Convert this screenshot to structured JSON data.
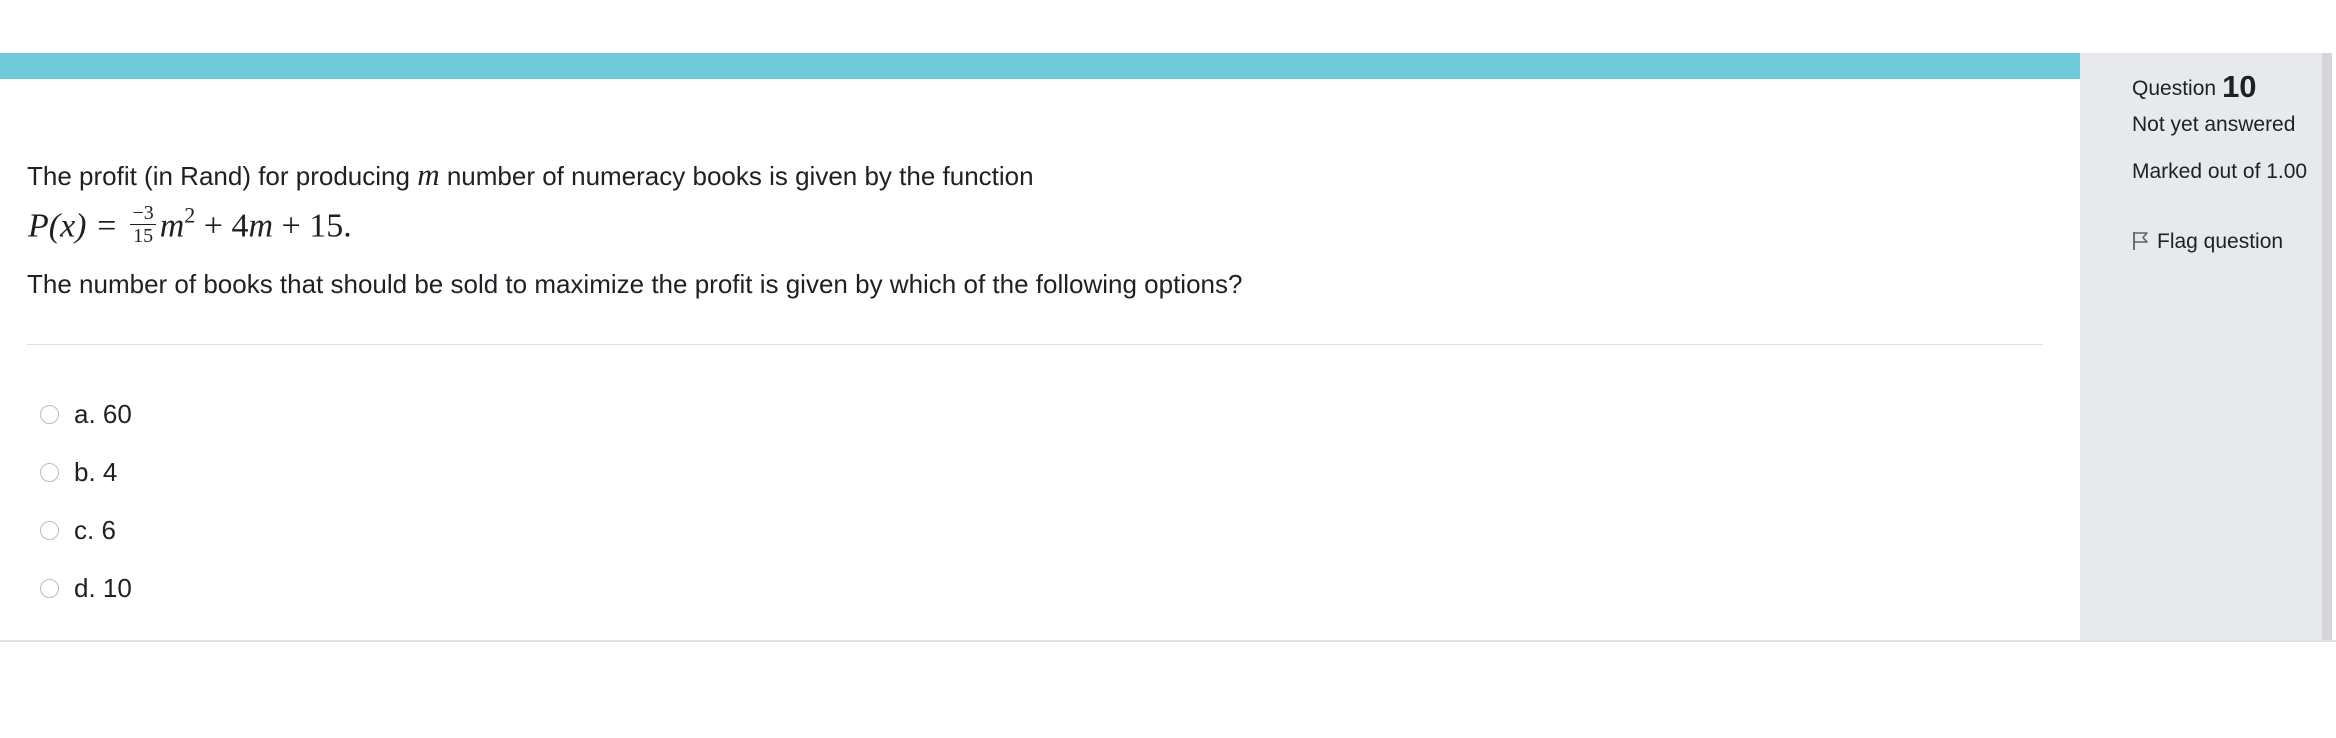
{
  "question": {
    "intro_before_var": "The profit (in Rand) for producing ",
    "variable": "m",
    "intro_after_var": " number of numeracy books is given by the function",
    "formula": {
      "lhs": "P(x) = ",
      "fraction_numerator": "−3",
      "fraction_denominator": "15",
      "var": "m",
      "exponent": "2",
      "plus_term_1": " + 4",
      "var2": "m",
      "tail": " + 15."
    },
    "prompt": "The number of books that should be sold to maximize the profit is given by which of the following options?"
  },
  "answers": [
    {
      "label": "a. 60"
    },
    {
      "label": "b. 4"
    },
    {
      "label": "c. 6"
    },
    {
      "label": "d. 10"
    }
  ],
  "info": {
    "question_label": "Question",
    "question_number": "10",
    "state": "Not yet answered",
    "grade": "Marked out of 1.00",
    "flag_label": "Flag question"
  },
  "colors": {
    "accent_bar": "#6fc9d8",
    "info_panel": "#e8e9ec"
  }
}
